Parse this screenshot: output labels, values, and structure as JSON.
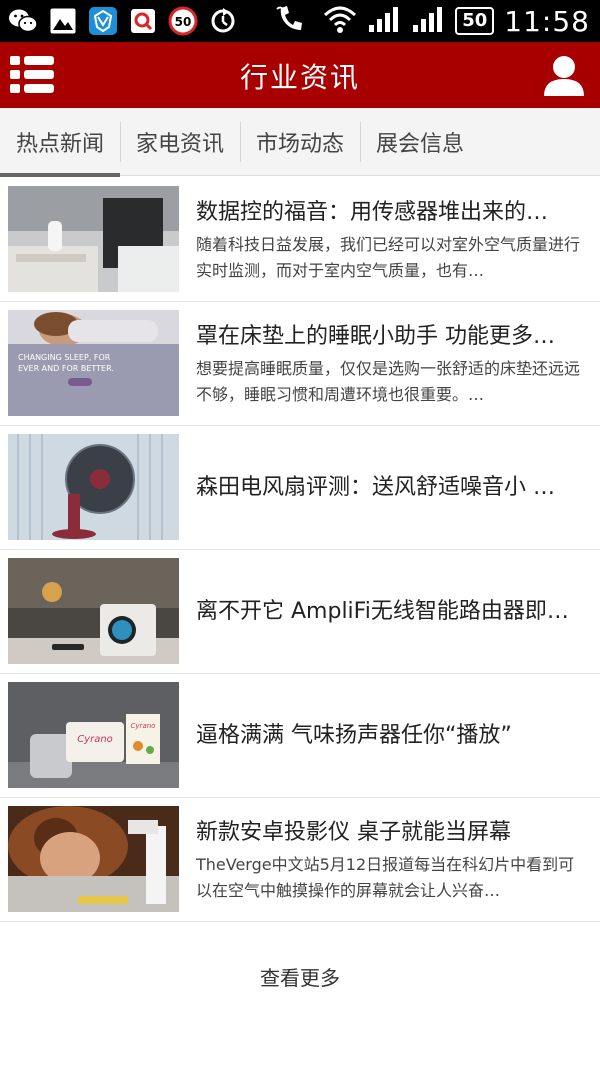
{
  "status_bar": {
    "notification_icons": [
      "wechat-icon",
      "image-icon",
      "shield-app-icon",
      "search-app-icon",
      "speed-50-icon",
      "sync-icon"
    ],
    "speed_badge": "50",
    "battery": "50",
    "time": "11:58"
  },
  "app_bar": {
    "title": "行业资讯",
    "menu_icon": "list-menu-icon",
    "user_icon": "user-icon"
  },
  "tabs": [
    {
      "label": "热点新闻",
      "active": true
    },
    {
      "label": "家电资讯",
      "active": false
    },
    {
      "label": "市场动态",
      "active": false
    },
    {
      "label": "展会信息",
      "active": false
    }
  ],
  "news": [
    {
      "title": "数据控的福音：用传感器堆出来的…",
      "desc": "随着科技日益发展，我们已经可以对室外空气质量进行实时监测，而对于室内空气质量，也有…",
      "thumb_text": ""
    },
    {
      "title": "罩在床垫上的睡眠小助手 功能更多…",
      "desc": "想要提高睡眠质量，仅仅是选购一张舒适的床垫还远远不够，睡眠习惯和周遭环境也很重要。…",
      "thumb_text": "CHANGING SLEEP, FOR EVER AND FOR BETTER."
    },
    {
      "title": "森田电风扇评测：送风舒适噪音小 …",
      "desc": "",
      "thumb_text": ""
    },
    {
      "title": "离不开它 AmpliFi无线智能路由器即…",
      "desc": "",
      "thumb_text": ""
    },
    {
      "title": "逼格满满 气味扬声器任你“播放”",
      "desc": "",
      "thumb_text": "Cyrano"
    },
    {
      "title": "新款安卓投影仪 桌子就能当屏幕",
      "desc": "TheVerge中文站5月12日报道每当在科幻片中看到可以在空气中触摸操作的屏幕就会让人兴奋…",
      "thumb_text": ""
    }
  ],
  "load_more": "查看更多",
  "colors": {
    "brand": "#a80000",
    "tab_bg": "#f4f4f4"
  }
}
